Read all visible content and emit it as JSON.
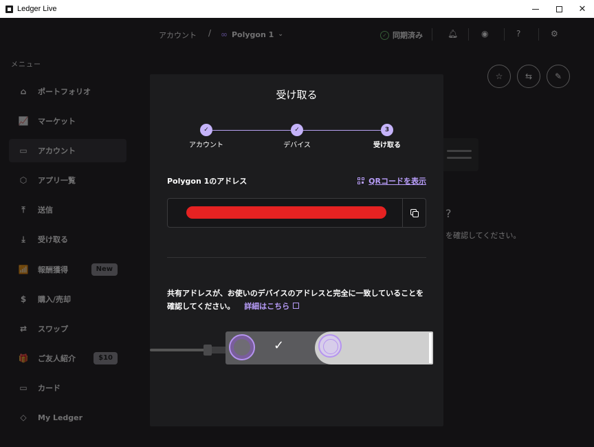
{
  "window": {
    "title": "Ledger Live",
    "minimize_label": "—",
    "maximize_label": "",
    "close_label": "✕"
  },
  "sidebar": {
    "menu_title": "メニュー",
    "items": [
      {
        "label": "ポートフォリオ",
        "icon": "home-icon",
        "glyph": "⌂"
      },
      {
        "label": "マーケット",
        "icon": "chart-icon",
        "glyph": "📈"
      },
      {
        "label": "アカウント",
        "icon": "wallet-icon",
        "glyph": "▭",
        "active": true
      },
      {
        "label": "アプリ一覧",
        "icon": "apps-icon",
        "glyph": "⬡"
      },
      {
        "label": "送信",
        "icon": "send-icon",
        "glyph": "⤒"
      },
      {
        "label": "受け取る",
        "icon": "receive-icon",
        "glyph": "⤓"
      },
      {
        "label": "報酬獲得",
        "icon": "earn-icon",
        "glyph": "📶",
        "badge": "New"
      },
      {
        "label": "購入/売却",
        "icon": "dollar-icon",
        "glyph": "$"
      },
      {
        "label": "スワップ",
        "icon": "swap-icon",
        "glyph": "⇄"
      },
      {
        "label": "ご友人紹介",
        "icon": "gift-icon",
        "glyph": "🎁",
        "badge": "$10"
      },
      {
        "label": "カード",
        "icon": "card-icon",
        "glyph": "▭"
      },
      {
        "label": "My Ledger",
        "icon": "ledger-icon",
        "glyph": "◇"
      }
    ]
  },
  "topbar": {
    "breadcrumb_root": "アカウント",
    "breadcrumb_sep": "/",
    "account_name": "Polygon 1",
    "sync_status": "同期済み"
  },
  "background": {
    "question_mark": "?",
    "partial_text": "を確認してください。"
  },
  "modal": {
    "title": "受け取る",
    "steps": [
      {
        "number": "✓",
        "label": "アカウント"
      },
      {
        "number": "✓",
        "label": "デバイス"
      },
      {
        "number": "3",
        "label": "受け取る"
      }
    ],
    "address_title": "Polygon 1のアドレス",
    "qr_link": "QRコードを表示",
    "address_value": "",
    "instruction_text": "共有アドレスが、お使いのデバイスのアドレスと完全に一致していることを確認してください。",
    "learn_more": "詳細はこちら",
    "device_check": "✓"
  },
  "colors": {
    "accent": "#bba4f7",
    "redaction": "#e52222",
    "sync_ok": "#6ed06e"
  }
}
